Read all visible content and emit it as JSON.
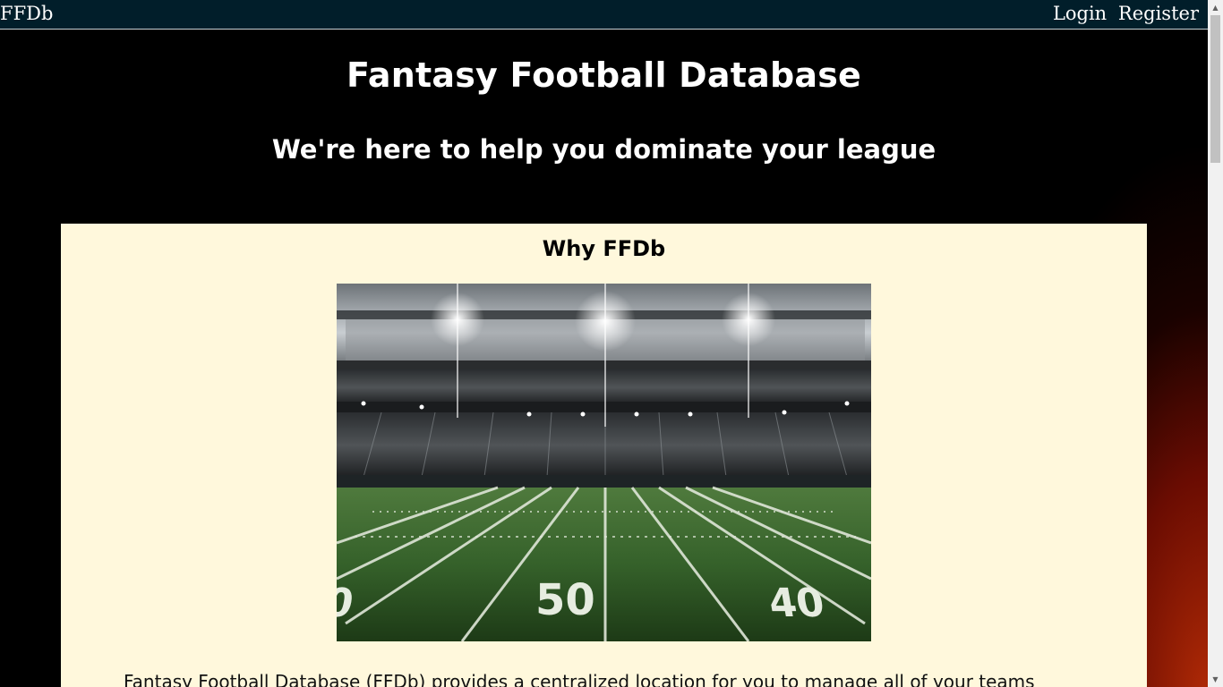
{
  "navbar": {
    "brand": "FFDb",
    "links": [
      "Login",
      "Register"
    ]
  },
  "hero": {
    "title": "Fantasy Football Database",
    "subtitle": "We're here to help you dominate your league"
  },
  "card": {
    "title": "Why FFDb",
    "image_icon": "stadium-image",
    "body": "Fantasy Football Database (FFDb) provides a centralized location for you to manage all of your teams"
  },
  "colors": {
    "nav_bg": "#011e2a",
    "card_bg": "#fff8dc",
    "page_bg": "#000000"
  }
}
